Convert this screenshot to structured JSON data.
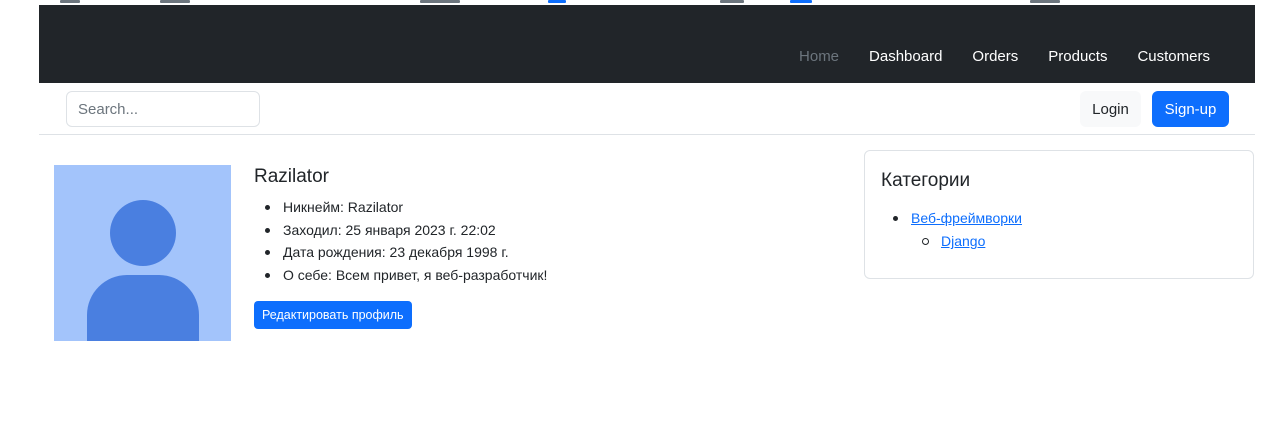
{
  "navbar": {
    "links": [
      {
        "label": "Home",
        "muted": true
      },
      {
        "label": "Dashboard"
      },
      {
        "label": "Orders"
      },
      {
        "label": "Products"
      },
      {
        "label": "Customers"
      }
    ]
  },
  "toolbar": {
    "search_placeholder": "Search...",
    "login_label": "Login",
    "signup_label": "Sign-up"
  },
  "profile": {
    "avatar_icon": "user-avatar-icon",
    "username": "Razilator",
    "details": [
      "Никнейм: Razilator",
      "Заходил: 25 января 2023 г. 22:02",
      "Дата рождения: 23 декабря 1998 г.",
      "О себе: Всем привет, я веб-разработчик!"
    ],
    "edit_label": "Редактировать профиль"
  },
  "categories": {
    "title": "Категории",
    "parent": "Веб-фреймворки",
    "child": "Django"
  },
  "colors": {
    "navbar_bg": "#212529",
    "primary": "#0d6efd",
    "avatar_bg": "#a3c4fb",
    "avatar_fg": "#4a7fe0"
  }
}
